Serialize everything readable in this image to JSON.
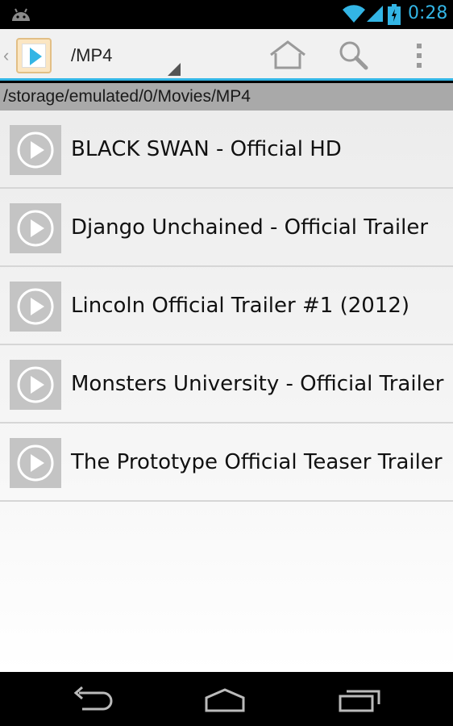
{
  "status_bar": {
    "time": "0:28",
    "icons": [
      "android-icon",
      "wifi-icon",
      "signal-icon",
      "battery-icon"
    ]
  },
  "action_bar": {
    "title": "/MP4",
    "icons": [
      "up-caret-icon",
      "video-player-app-icon",
      "home-icon",
      "search-icon",
      "overflow-menu-icon"
    ]
  },
  "path_bar": {
    "path": "/storage/emulated/0/Movies/MP4"
  },
  "files": [
    {
      "name": "BLACK SWAN - Official HD"
    },
    {
      "name": "Django Unchained - Official Trailer"
    },
    {
      "name": "Lincoln Official Trailer #1 (2012)"
    },
    {
      "name": "Monsters University - Official Trailer"
    },
    {
      "name": "The Prototype Official Teaser Trailer"
    }
  ],
  "nav_bar": {
    "icons": [
      "back-icon",
      "home-nav-icon",
      "recents-icon"
    ]
  },
  "colors": {
    "accent": "#33b5e5",
    "path_bar_bg": "#a9a9a9",
    "thumb_bg": "#c4c4c4"
  }
}
